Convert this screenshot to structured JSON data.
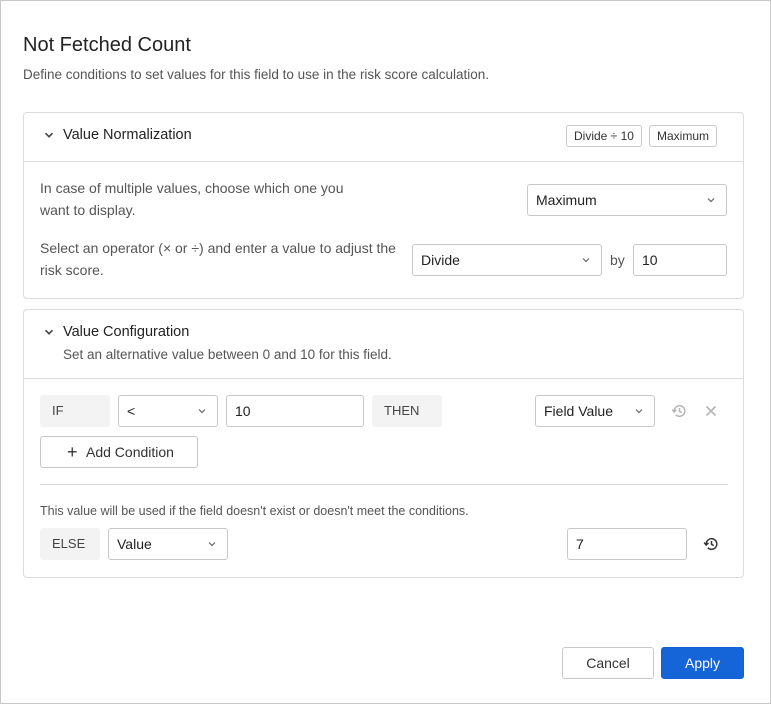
{
  "dialog": {
    "title": "Not Fetched Count",
    "subtitle": "Define conditions to set values for this field to use in the risk score calculation."
  },
  "normalization": {
    "title": "Value Normalization",
    "tags": [
      "Divide ÷ 10",
      "Maximum"
    ],
    "multiple_values_label_line1": "In case of multiple values, choose which one you",
    "multiple_values_label_line2": "want to display.",
    "multiple_values_selected": "Maximum",
    "operator_label_line1": "Select an operator (× or ÷) and enter a value to adjust the",
    "operator_label_line2": "risk score.",
    "operator_selected": "Divide",
    "by_label": "by",
    "operator_value": "10"
  },
  "configuration": {
    "title": "Value Configuration",
    "description": "Set an alternative value between 0 and 10 for this field.",
    "condition": {
      "if_label": "IF",
      "comparator": "<",
      "value": "10",
      "then_label": "THEN",
      "result": "Field Value"
    },
    "add_condition_label": "Add Condition",
    "else_note": "This value will be used if the field doesn't exist or doesn't meet the conditions.",
    "else_label": "ELSE",
    "else_type": "Value",
    "else_value": "7"
  },
  "footer": {
    "cancel_label": "Cancel",
    "apply_label": "Apply"
  },
  "colors": {
    "primary": "#1565d8",
    "border": "#c8c8c8",
    "chip_bg": "#f3f3f3"
  },
  "icons": [
    "chevron-down-icon",
    "caret-down-icon",
    "history-icon",
    "close-icon",
    "plus-icon"
  ]
}
